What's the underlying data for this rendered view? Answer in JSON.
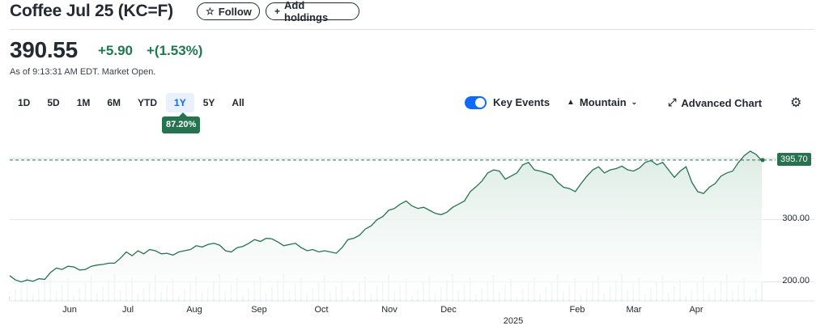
{
  "header": {
    "title": "Coffee Jul 25 (KC=F)",
    "follow_label": "Follow",
    "follow_icon": "star-outline-icon",
    "add_label": "Add holdings",
    "add_icon": "plus-icon"
  },
  "quote": {
    "price": "390.55",
    "change": "+5.90",
    "change_pct": "+(1.53%)",
    "as_of": "As of 9:13:31 AM EDT. Market Open."
  },
  "ranges": [
    {
      "label": "1D",
      "active": false
    },
    {
      "label": "5D",
      "active": false
    },
    {
      "label": "1M",
      "active": false
    },
    {
      "label": "6M",
      "active": false
    },
    {
      "label": "YTD",
      "active": false
    },
    {
      "label": "1Y",
      "active": true
    },
    {
      "label": "5Y",
      "active": false
    },
    {
      "label": "All",
      "active": false
    }
  ],
  "range_badge": "87.20%",
  "controls": {
    "key_events_label": "Key Events",
    "key_events_on": true,
    "chart_type_label": "Mountain",
    "advanced_label": "Advanced Chart",
    "settings_icon": "gear-icon"
  },
  "colors": {
    "positive": "#1d7a4f",
    "line": "#27734f",
    "fill_top": "#dcebe4",
    "toggle": "#0f69ff"
  },
  "chart_data": {
    "type": "area",
    "y_ticks": [
      "200.00",
      "300.00"
    ],
    "y_tick_values": [
      200,
      300
    ],
    "last_value_label": "395.70",
    "reference_value": 395.7,
    "x_ticks": [
      "Jun",
      "Jul",
      "Aug",
      "Sep",
      "Oct",
      "Nov",
      "Dec",
      "Feb",
      "Mar",
      "Apr"
    ],
    "x_year_label": "2025",
    "x_year_after": "Dec",
    "series": [
      {
        "values": [
          210,
          203,
          200,
          203,
          201,
          205,
          204,
          215,
          222,
          220,
          225,
          224,
          219,
          220,
          225,
          227,
          228,
          230,
          230,
          238,
          248,
          242,
          250,
          245,
          252,
          250,
          245,
          246,
          243,
          248,
          250,
          252,
          258,
          256,
          260,
          262,
          259,
          250,
          248,
          255,
          257,
          262,
          268,
          265,
          270,
          269,
          264,
          258,
          260,
          262,
          255,
          250,
          252,
          248,
          250,
          248,
          246,
          255,
          268,
          270,
          275,
          285,
          290,
          300,
          305,
          315,
          318,
          325,
          330,
          322,
          318,
          320,
          315,
          310,
          308,
          312,
          320,
          325,
          330,
          345,
          353,
          362,
          375,
          380,
          378,
          365,
          370,
          375,
          388,
          392,
          380,
          378,
          375,
          372,
          360,
          352,
          350,
          345,
          358,
          370,
          380,
          385,
          375,
          380,
          382,
          386,
          380,
          378,
          383,
          392,
          395,
          388,
          392,
          380,
          368,
          378,
          385,
          360,
          345,
          342,
          352,
          358,
          370,
          375,
          378,
          392,
          403,
          410,
          405,
          395
        ]
      }
    ],
    "y_range": [
      172,
      445
    ],
    "volume_bars": true
  }
}
